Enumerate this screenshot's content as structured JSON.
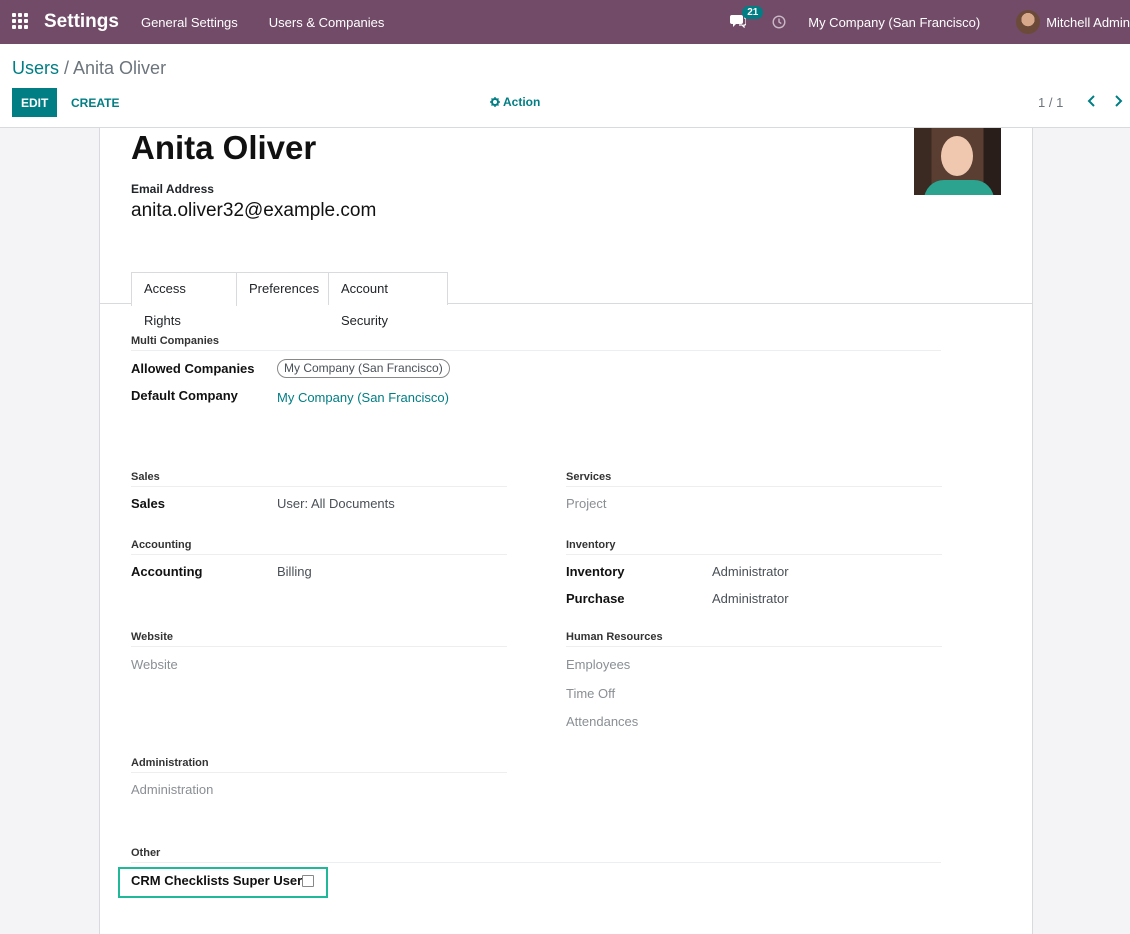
{
  "topbar": {
    "brand": "Settings",
    "nav": [
      "General Settings",
      "Users & Companies"
    ],
    "message_count": "21",
    "company": "My Company (San Francisco)",
    "user": "Mitchell Admin"
  },
  "control": {
    "breadcrumb_parent": "Users",
    "breadcrumb_sep": " / ",
    "breadcrumb_current": "Anita Oliver",
    "edit_label": "EDIT",
    "create_label": "CREATE",
    "action_label": "Action",
    "pager": "1 / 1"
  },
  "form": {
    "name": "Anita Oliver",
    "email_label": "Email Address",
    "email": "anita.oliver32@example.com",
    "tabs": [
      "Access Rights",
      "Preferences",
      "Account Security"
    ],
    "multi_companies": {
      "title": "Multi Companies",
      "allowed_label": "Allowed Companies",
      "allowed_tag": "My Company (San Francisco)",
      "default_label": "Default Company",
      "default_value": "My Company (San Francisco)"
    },
    "sales": {
      "title": "Sales",
      "label": "Sales",
      "value": "User: All Documents"
    },
    "services": {
      "title": "Services",
      "item": "Project"
    },
    "accounting": {
      "title": "Accounting",
      "label": "Accounting",
      "value": "Billing"
    },
    "inventory": {
      "title": "Inventory",
      "inventory_label": "Inventory",
      "inventory_value": "Administrator",
      "purchase_label": "Purchase",
      "purchase_value": "Administrator"
    },
    "website": {
      "title": "Website",
      "item": "Website"
    },
    "hr": {
      "title": "Human Resources",
      "items": [
        "Employees",
        "Time Off",
        "Attendances"
      ]
    },
    "administration": {
      "title": "Administration",
      "item": "Administration"
    },
    "other": {
      "title": "Other",
      "crm_label": "CRM Checklists Super User",
      "crm_checked": false
    }
  }
}
